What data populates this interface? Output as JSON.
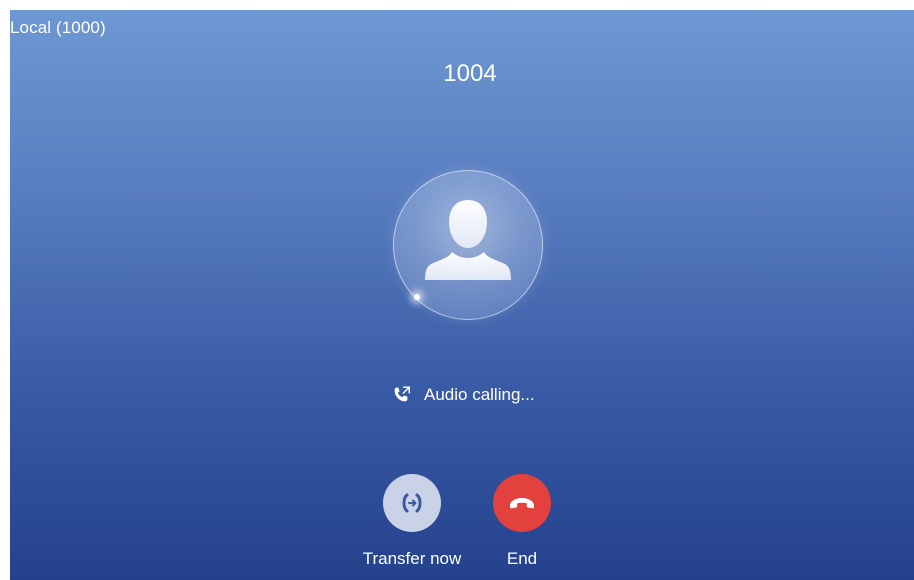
{
  "header": {
    "account_label": "Local (1000)"
  },
  "call": {
    "callee_number": "1004",
    "status_text": "Audio calling..."
  },
  "actions": {
    "transfer_label": "Transfer now",
    "end_label": "End"
  },
  "icons": {
    "avatar": "person-silhouette-icon",
    "status": "outgoing-call-icon",
    "transfer": "transfer-call-icon",
    "end": "hang-up-icon"
  },
  "colors": {
    "background_top": "#6d98d2",
    "background_bottom": "#24418c",
    "end_button": "#e2413d",
    "transfer_button": "#c9d2e6",
    "text": "#ffffff"
  }
}
